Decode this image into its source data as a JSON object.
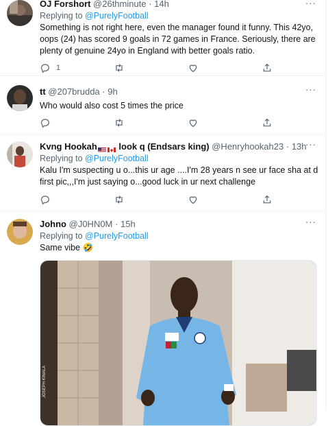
{
  "tweets": [
    {
      "name": "OJ Forshort",
      "handle": "@26thminute",
      "time": "14h",
      "replying_prefix": "Replying to ",
      "replying_to": "@PurelyFootball",
      "text": "Something is not right here, even the manager found it funny. This 42yo, oops (24) has scored 9 goals in 72 games in France. Seriously, there are plenty of genuine 24yo in England with better goals ratio.",
      "reply_count": "1"
    },
    {
      "name": "tt",
      "handle": "@207brudda",
      "time": "9h",
      "text": "Who would also cost 5 times the price",
      "reply_count": ""
    },
    {
      "name": "Kvng Hookah",
      "name_suffix": "look q (Endsars king)",
      "handle": "@Henryhookah23",
      "time": "13h",
      "replying_prefix": "Replying to ",
      "replying_to": "@PurelyFootball",
      "text": "Kalu I'm suspecting u o...this ur age ....I'm 28 years n see ur face sha at d first pic,,,I'm just saying o...good luck in ur next challenge",
      "reply_count": ""
    },
    {
      "name": "Johno",
      "handle": "@J0HN0M",
      "time": "15h",
      "replying_prefix": "Replying to ",
      "replying_to": "@PurelyFootball",
      "text": "Same vibe 🤣"
    }
  ],
  "separator": "·",
  "more_label": "···",
  "image_watermark": "JOSEPH KINALA",
  "icons": [
    "reply-icon",
    "retweet-icon",
    "like-icon",
    "share-icon",
    "more-icon"
  ],
  "colors": {
    "accent": "#1d9bf0",
    "secondary_text": "#536471",
    "divider": "#eff3f4"
  }
}
